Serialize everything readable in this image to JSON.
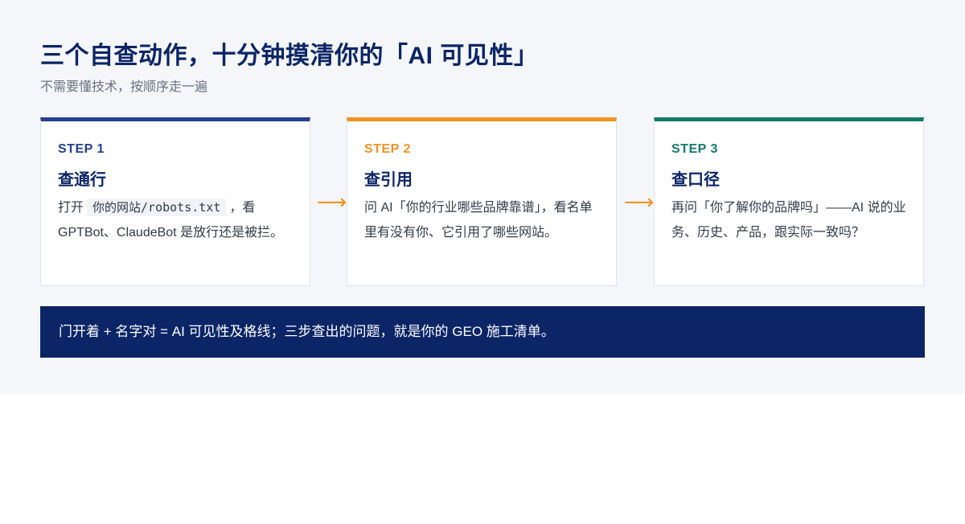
{
  "header": {
    "title": "三个自查动作，十分钟摸清你的「AI 可见性」",
    "subtitle": "不需要懂技术，按顺序走一遍"
  },
  "steps": [
    {
      "label": "STEP 1",
      "title": "查通行",
      "body_before": "打开",
      "body_code": "你的网站/robots.txt",
      "body_after": "，看 GPTBot、ClaudeBot 是放行还是被拦。",
      "color": "#24408e"
    },
    {
      "label": "STEP 2",
      "title": "查引用",
      "body": "问 AI「你的行业哪些品牌靠谱」，看名单里有没有你、它引用了哪些网站。",
      "color": "#f0931f"
    },
    {
      "label": "STEP 3",
      "title": "查口径",
      "body": "再问「你了解你的品牌吗」——AI 说的业务、历史、产品，跟实际一致吗？",
      "color": "#137a6c"
    }
  ],
  "arrows": {
    "glyph": "⟶",
    "icon": "arrow-right-icon",
    "color": "#f0931f"
  },
  "banner": {
    "text": "门开着 + 名字对 = AI 可见性及格线；三步查出的问题，就是你的 GEO 施工清单。",
    "color": "#0b2566"
  }
}
